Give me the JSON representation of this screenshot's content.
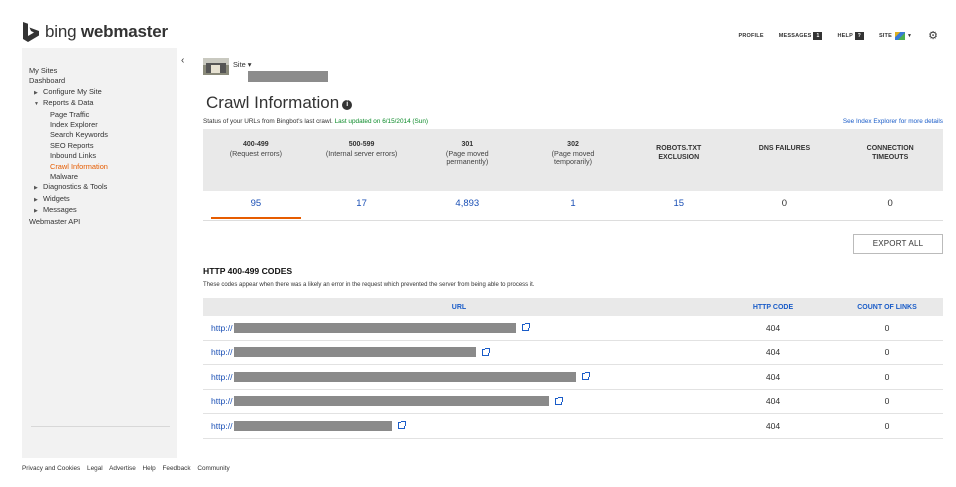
{
  "brand": {
    "logo_text_light": "bing",
    "logo_text_bold": "webmaster"
  },
  "topnav": {
    "profile": "PROFILE",
    "messages": "MESSAGES",
    "messages_count": "1",
    "help": "HELP",
    "help_icon": "?",
    "site": "SITE",
    "settings_icon": "gear-icon"
  },
  "sidebar": {
    "items": [
      {
        "label": "My Sites"
      },
      {
        "label": "Dashboard"
      },
      {
        "label": "Configure My Site"
      },
      {
        "label": "Reports & Data"
      },
      {
        "label": "Page Traffic"
      },
      {
        "label": "Index Explorer"
      },
      {
        "label": "Search Keywords"
      },
      {
        "label": "SEO Reports"
      },
      {
        "label": "Inbound Links"
      },
      {
        "label": "Crawl Information"
      },
      {
        "label": "Malware"
      },
      {
        "label": "Diagnostics & Tools"
      },
      {
        "label": "Widgets"
      },
      {
        "label": "Messages"
      },
      {
        "label": "Webmaster API"
      }
    ]
  },
  "site_selector": {
    "label": "Site ▾"
  },
  "page": {
    "title": "Crawl Information",
    "status_prefix": "Status of your URLs from Bingbot's last crawl.",
    "status_updated": "Last updated on 6/15/2014 (Sun)",
    "index_link": "See Index Explorer for more details"
  },
  "stats": [
    {
      "code": "400-499",
      "desc": "(Request errors)",
      "value": "95"
    },
    {
      "code": "500-599",
      "desc": "(Internal server errors)",
      "value": "17"
    },
    {
      "code": "301",
      "desc": "(Page moved\npermanently)",
      "value": "4,893"
    },
    {
      "code": "302",
      "desc": "(Page moved\ntemporarily)",
      "value": "1"
    },
    {
      "code": "ROBOTS.TXT\nEXCLUSION",
      "desc": "",
      "value": "15"
    },
    {
      "code": "DNS FAILURES",
      "desc": "",
      "value": "0"
    },
    {
      "code": "CONNECTION\nTIMEOUTS",
      "desc": "",
      "value": "0"
    }
  ],
  "export_label": "EXPORT ALL",
  "section": {
    "title": "HTTP 400-499 CODES",
    "desc": "These codes appear when there was a likely an error in the request which prevented the server from being able to process it."
  },
  "table": {
    "headers": {
      "url": "URL",
      "code": "HTTP CODE",
      "links": "COUNT OF LINKS"
    },
    "rows": [
      {
        "url": "http://",
        "code": "404",
        "links": "0"
      },
      {
        "url": "http://",
        "code": "404",
        "links": "0"
      },
      {
        "url": "http://",
        "code": "404",
        "links": "0"
      },
      {
        "url": "http://",
        "code": "404",
        "links": "0"
      },
      {
        "url": "http://",
        "code": "404",
        "links": "0"
      }
    ]
  },
  "footer": [
    "Privacy and Cookies",
    "Legal",
    "Advertise",
    "Help",
    "Feedback",
    "Community"
  ],
  "colors": {
    "accent": "#e65c00",
    "link": "#1a5cc8",
    "updated": "#0a8a28"
  }
}
